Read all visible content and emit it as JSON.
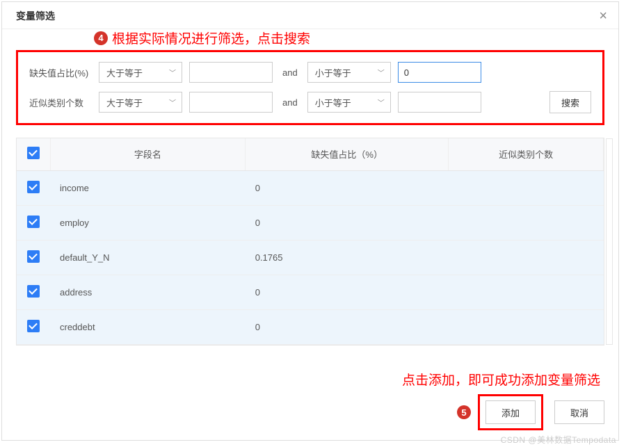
{
  "dialog": {
    "title": "变量筛选"
  },
  "annotations": {
    "top_num": "4",
    "top_text": "根据实际情况进行筛选，点击搜索",
    "bot_num": "5",
    "bot_text": "点击添加，即可成功添加变量筛选"
  },
  "filter": {
    "row1": {
      "label": "缺失值占比(%)",
      "op1": "大于等于",
      "val1": "",
      "conj": "and",
      "op2": "小于等于",
      "val2": "0"
    },
    "row2": {
      "label": "近似类别个数",
      "op1": "大于等于",
      "val1": "",
      "conj": "and",
      "op2": "小于等于",
      "val2": ""
    },
    "search_label": "搜索"
  },
  "table": {
    "headers": [
      "",
      "字段名",
      "缺失值占比（%）",
      "近似类别个数"
    ],
    "rows": [
      {
        "name": "income",
        "missing": "0",
        "cats": ""
      },
      {
        "name": "employ",
        "missing": "0",
        "cats": ""
      },
      {
        "name": "default_Y_N",
        "missing": "0.1765",
        "cats": ""
      },
      {
        "name": "address",
        "missing": "0",
        "cats": ""
      },
      {
        "name": "creddebt",
        "missing": "0",
        "cats": ""
      }
    ]
  },
  "footer": {
    "add": "添加",
    "cancel": "取消"
  },
  "watermark": "CSDN @美林数据Tempodata"
}
